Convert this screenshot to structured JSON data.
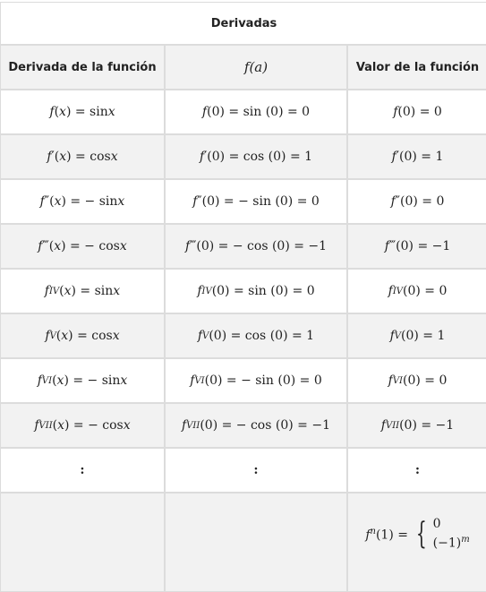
{
  "table": {
    "title": "Derivadas",
    "headers": [
      "Derivada de la función",
      "f(a)",
      "Valor de la función"
    ],
    "rows": [
      [
        "f(x) = sin x",
        "f(0) = sin (0) = 0",
        "f(0) = 0"
      ],
      [
        "f′(x) = cos x",
        "f′(0) = cos (0) = 1",
        "f′(0) = 1"
      ],
      [
        "f″(x) = − sin x",
        "f″(0) = − sin (0) = 0",
        "f″(0) = 0"
      ],
      [
        "f‴(x) = − cos x",
        "f‴(0) = − cos (0) = −1",
        "f‴(0) = −1"
      ],
      [
        "fIV(x) = sin x",
        "fIV(0) = sin (0) = 0",
        "fIV(0) = 0"
      ],
      [
        "fV(x) = cos x",
        "fV(0) = cos (0) = 1",
        "fV(0) = 1"
      ],
      [
        "fVI(x) = − sin x",
        "fVI(0) = − sin (0) = 0",
        "fVI(0) = 0"
      ],
      [
        "fVII(x) = − cos x",
        "fVII(0) = − cos (0) = −1",
        "fVII(0) = −1"
      ],
      [
        ":",
        ":",
        ":"
      ]
    ],
    "last_row": {
      "col1": "",
      "col2": "",
      "formula_lhs": "fn(1) =",
      "case_1": "0",
      "case_2": "(−1)m"
    }
  }
}
